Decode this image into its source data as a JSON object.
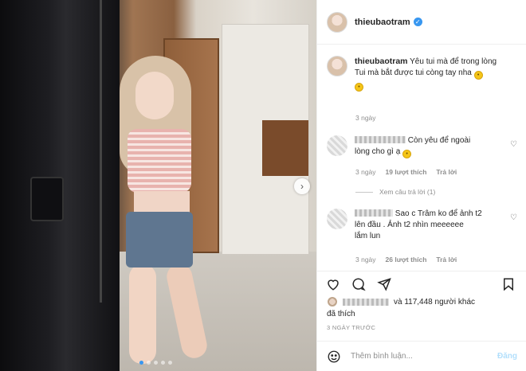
{
  "post": {
    "username": "thieubaotram",
    "verified_mark": "✓",
    "caption_line1": "Yêu tui mà để trong lòng",
    "caption_line2": "Tui mà bắt được tui còng tay nha",
    "caption_time": "3 ngày"
  },
  "comments": [
    {
      "text_a": "Còn yêu để ngoài",
      "text_b": "lòng cho gì ạ",
      "time": "3 ngày",
      "likes": "19 lượt thích",
      "reply": "Trả lời"
    },
    {
      "text_a": "Sao c Trâm ko để ảnh t2",
      "text_b": "lên đầu . Ảnh t2 nhìn meeeeee",
      "text_c": "lắm lun",
      "time": "3 ngày",
      "likes": "26 lượt thích",
      "reply": "Trả lời"
    }
  ],
  "view_replies": "Xem câu trả lời (1)",
  "likes_summary": {
    "text": "và 117,448 người khác",
    "second_line": "đã thích"
  },
  "timestamp": "3 NGÀY TRƯỚC",
  "comment_box": {
    "placeholder": "Thêm bình luận...",
    "post_label": "Đăng"
  },
  "icons": {
    "heart": "heart-icon",
    "comment": "comment-icon",
    "share": "share-icon",
    "save": "bookmark-icon",
    "emoji": "emoji-icon",
    "next": "chevron-right-icon"
  },
  "colors": {
    "accent": "#3897f0",
    "post_disabled": "#b2dffc",
    "meta_text": "#8e8e8e"
  },
  "carousel": {
    "count": 5,
    "active": 1
  }
}
